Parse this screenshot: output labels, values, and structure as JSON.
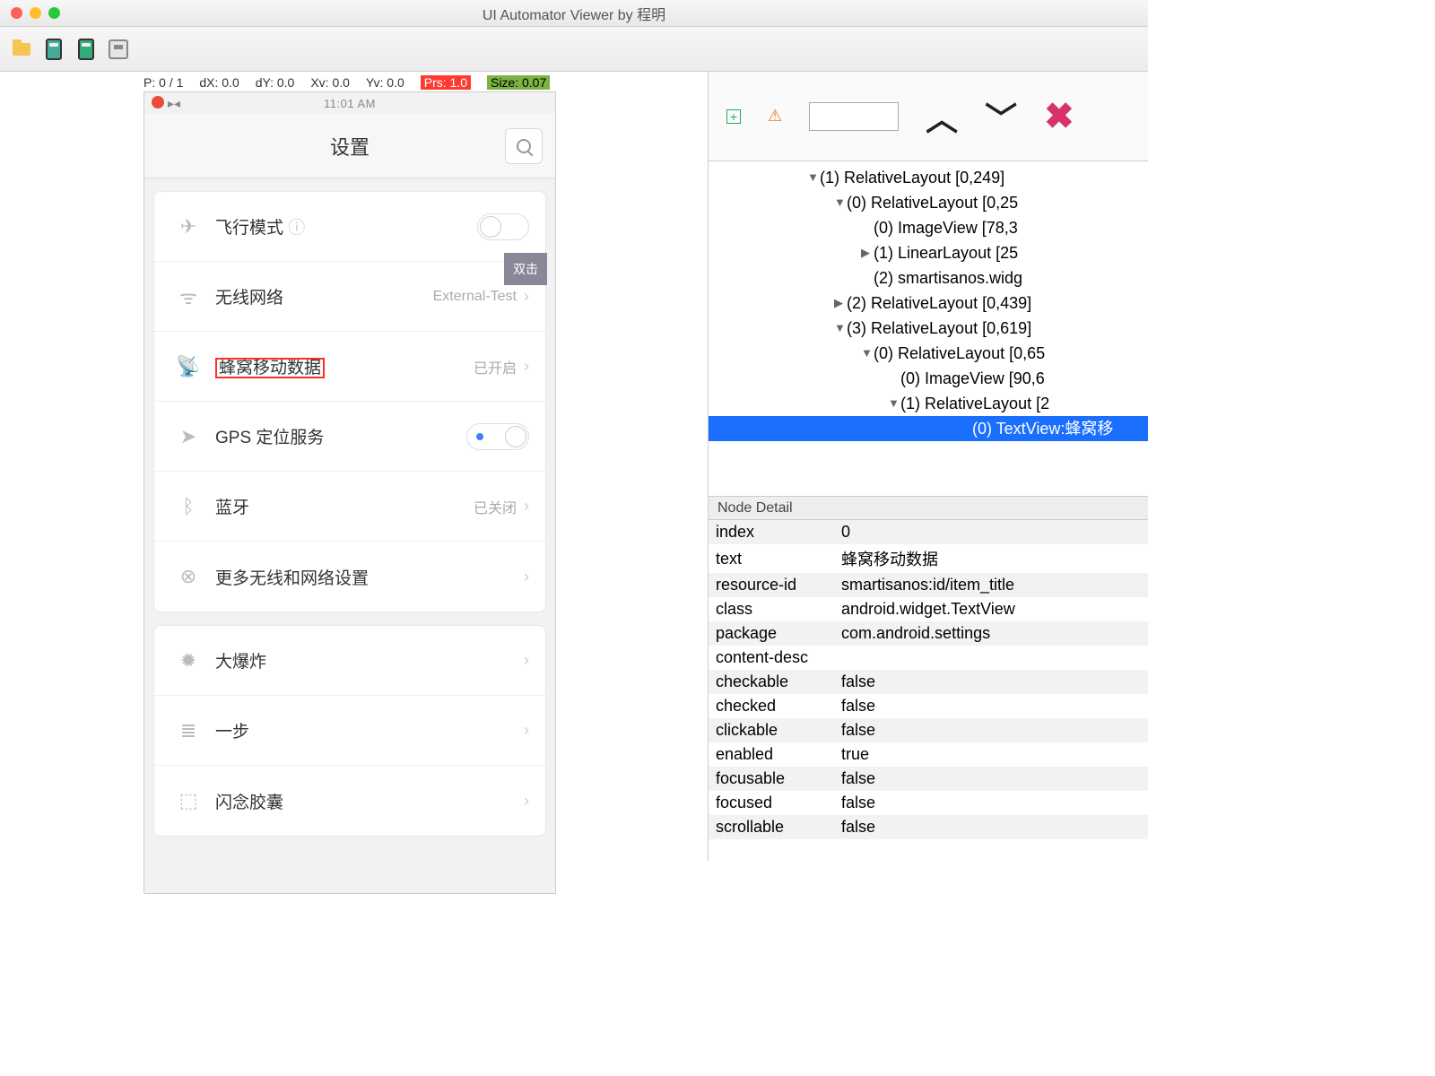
{
  "window": {
    "title": "UI Automator Viewer by 程明"
  },
  "coords": {
    "p": "P: 0 / 1",
    "dx": "dX: 0.0",
    "dy": "dY: 0.0",
    "xv": "Xv: 0.0",
    "yv": "Yv: 0.0",
    "prs": "Prs: 1.0",
    "size": "Size: 0.07"
  },
  "device": {
    "time": "11:01 AM",
    "header_title": "设置",
    "dbl_click": "双击",
    "rows_group1": [
      {
        "icon": "✈",
        "label": "飞行模式",
        "type": "toggle_off",
        "info": true
      },
      {
        "icon": "wifi",
        "label": "无线网络",
        "type": "value",
        "value": "External-Test",
        "badge": true
      },
      {
        "icon": "ant",
        "label": "蜂窝移动数据",
        "type": "value",
        "value": "已开启",
        "highlight": true
      },
      {
        "icon": "nav",
        "label": "GPS 定位服务",
        "type": "toggle_on"
      },
      {
        "icon": "bt",
        "label": "蓝牙",
        "type": "value",
        "value": "已关闭"
      },
      {
        "icon": "net",
        "label": "更多无线和网络设置",
        "type": "nav"
      }
    ],
    "rows_group2": [
      {
        "icon": "burst",
        "label": "大爆炸",
        "type": "nav"
      },
      {
        "icon": "step",
        "label": "一步",
        "type": "nav"
      },
      {
        "icon": "cap",
        "label": "闪念胶囊",
        "type": "nav"
      }
    ]
  },
  "tree": [
    {
      "ind": 1,
      "arrow": "▼",
      "text": "(1) RelativeLayout [0,249]"
    },
    {
      "ind": 2,
      "arrow": "▼",
      "text": "(0) RelativeLayout [0,25"
    },
    {
      "ind": 3,
      "arrow": "",
      "text": "(0) ImageView [78,3"
    },
    {
      "ind": 3,
      "arrow": "▶",
      "text": "(1) LinearLayout [25"
    },
    {
      "ind": 3,
      "arrow": "",
      "text": "(2) smartisanos.widg"
    },
    {
      "ind": 2,
      "arrow": "▶",
      "text": "(2) RelativeLayout [0,439]"
    },
    {
      "ind": 2,
      "arrow": "▼",
      "text": "(3) RelativeLayout [0,619]"
    },
    {
      "ind": 3,
      "arrow": "▼",
      "text": "(0) RelativeLayout [0,65"
    },
    {
      "ind": 4,
      "arrow": "",
      "text": "(0) ImageView [90,6"
    },
    {
      "ind": 4,
      "arrow": "▼",
      "text": "(1) RelativeLayout [2"
    },
    {
      "ind": 7,
      "arrow": "",
      "text": "(0) TextView:蜂窝移",
      "sel": true
    }
  ],
  "detail_header": "Node Detail",
  "detail": [
    {
      "k": "index",
      "v": "0"
    },
    {
      "k": "text",
      "v": "蜂窝移动数据"
    },
    {
      "k": "resource-id",
      "v": "smartisanos:id/item_title"
    },
    {
      "k": "class",
      "v": "android.widget.TextView"
    },
    {
      "k": "package",
      "v": "com.android.settings"
    },
    {
      "k": "content-desc",
      "v": ""
    },
    {
      "k": "checkable",
      "v": "false"
    },
    {
      "k": "checked",
      "v": "false"
    },
    {
      "k": "clickable",
      "v": "false"
    },
    {
      "k": "enabled",
      "v": "true"
    },
    {
      "k": "focusable",
      "v": "false"
    },
    {
      "k": "focused",
      "v": "false"
    },
    {
      "k": "scrollable",
      "v": "false"
    }
  ]
}
